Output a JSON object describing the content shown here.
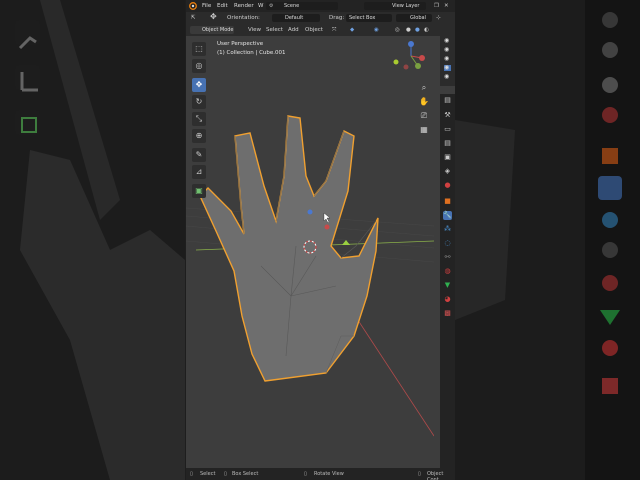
{
  "menu": {
    "file": "File",
    "edit": "Edit",
    "render": "Render",
    "w": "W",
    "scene": "Scene",
    "view_layer": "View Layer"
  },
  "toolbar": {
    "orientation_label": "Orientation:",
    "orientation_value": "Default",
    "drag_label": "Drag:",
    "drag_value": "Select Box",
    "transform_space": "Global"
  },
  "header": {
    "mode": "Object Mode",
    "view": "View",
    "select": "Select",
    "add": "Add",
    "object": "Object"
  },
  "viewport": {
    "perspective": "User Perspective",
    "collection": "(1) Collection | Cube.001"
  },
  "status": {
    "select": "Select",
    "box_select": "Box Select",
    "rotate_view": "Rotate View",
    "object_context": "Object Cont"
  },
  "colors": {
    "accent": "#4772b3",
    "selection_outline": "#f0a030",
    "panel": "#2b2b2b",
    "viewport": "#3d3d3d"
  }
}
